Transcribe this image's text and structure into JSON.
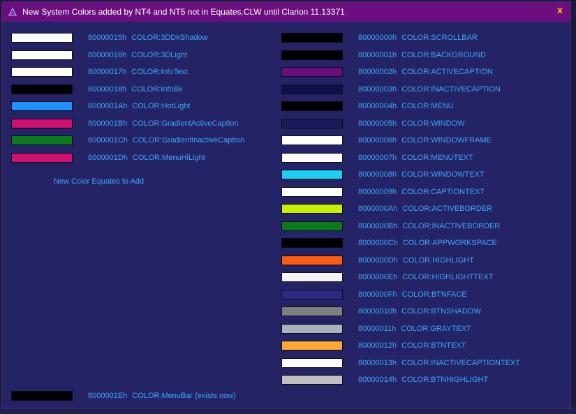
{
  "window": {
    "title": "New System Colors added by NT4 and NT5 not in Equates.CLW until Clarion 11.13371",
    "close_label": "x"
  },
  "left_colors": [
    {
      "code": "80000015h",
      "name": "COLOR:3DDkShadow",
      "color": "#ffffff"
    },
    {
      "code": "80000016h",
      "name": "COLOR:3DLight",
      "color": "#ffffff"
    },
    {
      "code": "80000017h",
      "name": "COLOR:InfoText",
      "color": "#ffffff"
    },
    {
      "code": "80000018h",
      "name": "COLOR:InfoBk",
      "color": "#000000"
    },
    {
      "code": "8000001Ah",
      "name": "COLOR:HotLight",
      "color": "#1e90ff"
    },
    {
      "code": "8000001Bh",
      "name": "COLOR:GradientActiveCaption",
      "color": "#d0106e"
    },
    {
      "code": "8000001Ch",
      "name": "COLOR:GradientInactiveCaption",
      "color": "#0a7a1a"
    },
    {
      "code": "8000001Dh",
      "name": "COLOR:MenuHiLight",
      "color": "#d0106e"
    }
  ],
  "section_label": "New Color Equates to Add",
  "menubar_color": {
    "code": "8000001Eh",
    "name": "COLOR:MenuBar (exists now)",
    "color": "#000000"
  },
  "right_colors": [
    {
      "code": "80000000h",
      "name": "COLOR:SCROLLBAR",
      "color": "#000000"
    },
    {
      "code": "80000001h",
      "name": "COLOR:BACKGROUND",
      "color": "#000000"
    },
    {
      "code": "80000002h",
      "name": "COLOR:ACTIVECAPTION",
      "color": "#6b0f7f"
    },
    {
      "code": "80000003h",
      "name": "COLOR:INACTIVECAPTION",
      "color": "#10104a"
    },
    {
      "code": "80000004h",
      "name": "COLOR:MENU",
      "color": "#000000"
    },
    {
      "code": "80000005h",
      "name": "COLOR:WINDOW",
      "color": "#1a1a5a"
    },
    {
      "code": "80000006h",
      "name": "COLOR:WINDOWFRAME",
      "color": "#ffffff"
    },
    {
      "code": "80000007h",
      "name": "COLOR:MENUTEXT",
      "color": "#ffffff"
    },
    {
      "code": "80000008h",
      "name": "COLOR:WINDOWTEXT",
      "color": "#1ad0f0"
    },
    {
      "code": "80000009h",
      "name": "COLOR:CAPTIONTEXT",
      "color": "#ffffff"
    },
    {
      "code": "8000000Ah",
      "name": "COLOR:ACTIVEBORDER",
      "color": "#c8f000"
    },
    {
      "code": "8000000Bh",
      "name": "COLOR:INACTIVEBORDER",
      "color": "#0a7a1a"
    },
    {
      "code": "8000000Ch",
      "name": "COLOR:APPWORKSPACE",
      "color": "#000000"
    },
    {
      "code": "8000000Dh",
      "name": "COLOR:HIGHLIGHT",
      "color": "#ff5a10"
    },
    {
      "code": "8000000Eh",
      "name": "COLOR:HIGHLIGHTTEXT",
      "color": "#f4f4f4"
    },
    {
      "code": "8000000Fh",
      "name": "COLOR:BTNFACE",
      "color": "#2a2a80"
    },
    {
      "code": "80000010h",
      "name": "COLOR:BTNSHADOW",
      "color": "#808080"
    },
    {
      "code": "80000011h",
      "name": "COLOR:GRAYTEXT",
      "color": "#a8b4bc"
    },
    {
      "code": "80000012h",
      "name": "COLOR:BTNTEXT",
      "color": "#ffa930"
    },
    {
      "code": "80000013h",
      "name": "COLOR:INACTIVECAPTIONTEXT",
      "color": "#ffffff"
    },
    {
      "code": "80000014h",
      "name": "COLOR:BTNHIGHLIGHT",
      "color": "#c0c0c0"
    }
  ]
}
